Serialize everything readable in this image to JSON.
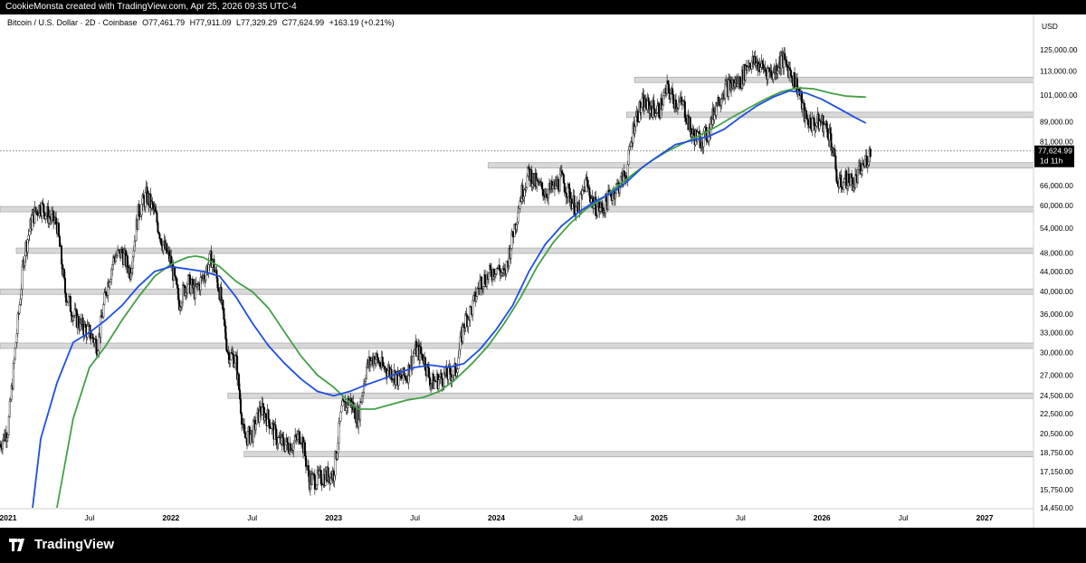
{
  "header": {
    "attribution": "CookieMonsta created with TradingView.com, Apr 25, 2026 09:35 UTC-4"
  },
  "footer": {
    "brand": "TradingView"
  },
  "chart_data": {
    "type": "candlestick",
    "symbol_line": "Bitcoin / U.S. Dollar · 2D · Coinbase",
    "ohlc": {
      "open_label": "O77,461.79",
      "high_label": "H77,911.09",
      "low_label": "L77,329.29",
      "close_label": "C77,624.99",
      "change_label": "+163.19 (+0.21%)"
    },
    "currency": "USD",
    "y_scale": "log",
    "ylim": [
      14450,
      131000
    ],
    "price_ticks": [
      "125,000.00",
      "113,000.00",
      "101,000.00",
      "89,000.00",
      "81,000.00",
      "66,000.00",
      "60,000.00",
      "54,000.00",
      "48,000.00",
      "44,000.00",
      "40,000.00",
      "36,000.00",
      "33,000.00",
      "30,000.00",
      "27,000.00",
      "24,500.00",
      "22,500.00",
      "20,500.00",
      "18,750.00",
      "17,150.00",
      "15,750.00",
      "14,450.00"
    ],
    "price_tick_values": [
      125000,
      113000,
      101000,
      89000,
      81000,
      66000,
      60000,
      54000,
      48000,
      44000,
      40000,
      36000,
      33000,
      30000,
      27000,
      24500,
      22500,
      20500,
      18750,
      17150,
      15750,
      14450
    ],
    "last_price": {
      "label": "77,624.99",
      "value": 77625,
      "countdown": "1d 11h"
    },
    "x_ticks": [
      {
        "label": "2021",
        "t": 2021.0,
        "bold": true
      },
      {
        "label": "Jul",
        "t": 2021.5,
        "bold": false
      },
      {
        "label": "2022",
        "t": 2022.0,
        "bold": true
      },
      {
        "label": "Jul",
        "t": 2022.5,
        "bold": false
      },
      {
        "label": "2023",
        "t": 2023.0,
        "bold": true
      },
      {
        "label": "Jul",
        "t": 2023.5,
        "bold": false
      },
      {
        "label": "2024",
        "t": 2024.0,
        "bold": true
      },
      {
        "label": "Jul",
        "t": 2024.5,
        "bold": false
      },
      {
        "label": "2025",
        "t": 2025.0,
        "bold": true
      },
      {
        "label": "Jul",
        "t": 2025.5,
        "bold": false
      },
      {
        "label": "2026",
        "t": 2026.0,
        "bold": true
      },
      {
        "label": "Jul",
        "t": 2026.5,
        "bold": false
      },
      {
        "label": "2027",
        "t": 2027.0,
        "bold": true
      }
    ],
    "xlim": [
      2020.95,
      2027.3
    ],
    "horizontal_levels": [
      {
        "price": 108500,
        "start": 2024.85
      },
      {
        "price": 92000,
        "start": 2024.8
      },
      {
        "price": 72500,
        "start": 2023.95
      },
      {
        "price": 59000,
        "start": 2020.95
      },
      {
        "price": 48500,
        "start": 2021.05
      },
      {
        "price": 40000,
        "start": 2020.95
      },
      {
        "price": 31000,
        "start": 2020.95
      },
      {
        "price": 24500,
        "start": 2022.35
      },
      {
        "price": 18600,
        "start": 2022.45
      }
    ],
    "price_path": [
      [
        2020.95,
        19500
      ],
      [
        2021.0,
        21000
      ],
      [
        2021.05,
        32000
      ],
      [
        2021.1,
        48000
      ],
      [
        2021.15,
        57000
      ],
      [
        2021.2,
        60000
      ],
      [
        2021.25,
        57000
      ],
      [
        2021.3,
        55000
      ],
      [
        2021.35,
        40000
      ],
      [
        2021.4,
        36000
      ],
      [
        2021.45,
        34000
      ],
      [
        2021.5,
        33000
      ],
      [
        2021.55,
        31000
      ],
      [
        2021.6,
        40000
      ],
      [
        2021.65,
        47000
      ],
      [
        2021.7,
        48000
      ],
      [
        2021.75,
        44000
      ],
      [
        2021.8,
        58000
      ],
      [
        2021.85,
        63000
      ],
      [
        2021.9,
        58000
      ],
      [
        2021.95,
        50000
      ],
      [
        2022.0,
        46000
      ],
      [
        2022.05,
        38000
      ],
      [
        2022.1,
        42000
      ],
      [
        2022.15,
        40000
      ],
      [
        2022.2,
        43000
      ],
      [
        2022.25,
        47000
      ],
      [
        2022.3,
        40000
      ],
      [
        2022.35,
        30000
      ],
      [
        2022.4,
        29000
      ],
      [
        2022.45,
        20000
      ],
      [
        2022.5,
        20500
      ],
      [
        2022.55,
        23000
      ],
      [
        2022.6,
        22000
      ],
      [
        2022.65,
        20000
      ],
      [
        2022.7,
        19500
      ],
      [
        2022.75,
        19500
      ],
      [
        2022.8,
        20500
      ],
      [
        2022.85,
        16500
      ],
      [
        2022.9,
        16500
      ],
      [
        2022.95,
        16800
      ],
      [
        2023.0,
        17000
      ],
      [
        2023.05,
        23000
      ],
      [
        2023.1,
        24000
      ],
      [
        2023.15,
        22000
      ],
      [
        2023.2,
        28000
      ],
      [
        2023.25,
        29500
      ],
      [
        2023.3,
        28000
      ],
      [
        2023.35,
        27500
      ],
      [
        2023.4,
        26500
      ],
      [
        2023.45,
        27000
      ],
      [
        2023.5,
        30500
      ],
      [
        2023.55,
        29500
      ],
      [
        2023.6,
        26000
      ],
      [
        2023.65,
        26500
      ],
      [
        2023.7,
        27000
      ],
      [
        2023.75,
        27500
      ],
      [
        2023.8,
        34500
      ],
      [
        2023.85,
        37000
      ],
      [
        2023.9,
        42000
      ],
      [
        2023.95,
        43000
      ],
      [
        2024.0,
        45000
      ],
      [
        2024.05,
        43000
      ],
      [
        2024.1,
        52000
      ],
      [
        2024.15,
        63000
      ],
      [
        2024.2,
        70000
      ],
      [
        2024.25,
        66000
      ],
      [
        2024.3,
        64000
      ],
      [
        2024.35,
        65000
      ],
      [
        2024.4,
        68000
      ],
      [
        2024.45,
        63000
      ],
      [
        2024.5,
        58000
      ],
      [
        2024.55,
        67000
      ],
      [
        2024.6,
        60000
      ],
      [
        2024.65,
        59000
      ],
      [
        2024.7,
        63000
      ],
      [
        2024.75,
        66000
      ],
      [
        2024.8,
        70000
      ],
      [
        2024.85,
        90000
      ],
      [
        2024.9,
        97000
      ],
      [
        2024.95,
        95000
      ],
      [
        2025.0,
        94000
      ],
      [
        2025.05,
        104000
      ],
      [
        2025.1,
        98000
      ],
      [
        2025.15,
        96000
      ],
      [
        2025.2,
        84000
      ],
      [
        2025.25,
        82000
      ],
      [
        2025.3,
        84000
      ],
      [
        2025.35,
        97000
      ],
      [
        2025.4,
        104000
      ],
      [
        2025.45,
        106000
      ],
      [
        2025.5,
        108000
      ],
      [
        2025.55,
        118000
      ],
      [
        2025.6,
        117000
      ],
      [
        2025.65,
        114000
      ],
      [
        2025.7,
        112000
      ],
      [
        2025.75,
        120000
      ],
      [
        2025.8,
        114000
      ],
      [
        2025.85,
        105000
      ],
      [
        2025.9,
        90000
      ],
      [
        2025.95,
        88000
      ],
      [
        2026.0,
        89000
      ],
      [
        2026.05,
        84000
      ],
      [
        2026.1,
        66000
      ],
      [
        2026.15,
        68000
      ],
      [
        2026.2,
        67000
      ],
      [
        2026.25,
        72000
      ],
      [
        2026.3,
        77500
      ]
    ],
    "ma_blue": [
      [
        2021.15,
        14450
      ],
      [
        2021.2,
        20000
      ],
      [
        2021.3,
        26000
      ],
      [
        2021.4,
        31500
      ],
      [
        2021.5,
        33000
      ],
      [
        2021.6,
        35000
      ],
      [
        2021.7,
        37500
      ],
      [
        2021.8,
        41000
      ],
      [
        2021.9,
        44000
      ],
      [
        2022.0,
        45000
      ],
      [
        2022.1,
        44500
      ],
      [
        2022.2,
        44000
      ],
      [
        2022.3,
        43000
      ],
      [
        2022.4,
        39000
      ],
      [
        2022.5,
        34500
      ],
      [
        2022.6,
        31000
      ],
      [
        2022.7,
        28500
      ],
      [
        2022.8,
        26500
      ],
      [
        2022.9,
        25000
      ],
      [
        2023.0,
        24500
      ],
      [
        2023.1,
        25000
      ],
      [
        2023.2,
        25800
      ],
      [
        2023.3,
        26500
      ],
      [
        2023.4,
        27300
      ],
      [
        2023.5,
        28000
      ],
      [
        2023.6,
        28300
      ],
      [
        2023.7,
        28000
      ],
      [
        2023.8,
        28500
      ],
      [
        2023.9,
        30500
      ],
      [
        2024.0,
        33500
      ],
      [
        2024.1,
        37500
      ],
      [
        2024.2,
        44000
      ],
      [
        2024.3,
        50000
      ],
      [
        2024.4,
        54500
      ],
      [
        2024.5,
        58000
      ],
      [
        2024.6,
        61000
      ],
      [
        2024.7,
        63500
      ],
      [
        2024.8,
        67000
      ],
      [
        2024.9,
        72000
      ],
      [
        2025.0,
        76000
      ],
      [
        2025.1,
        80000
      ],
      [
        2025.2,
        81500
      ],
      [
        2025.3,
        83000
      ],
      [
        2025.4,
        86000
      ],
      [
        2025.5,
        91000
      ],
      [
        2025.6,
        96000
      ],
      [
        2025.7,
        100000
      ],
      [
        2025.8,
        103000
      ],
      [
        2025.9,
        102000
      ],
      [
        2026.0,
        99000
      ],
      [
        2026.1,
        95000
      ],
      [
        2026.2,
        91000
      ],
      [
        2026.27,
        88500
      ]
    ],
    "ma_green": [
      [
        2021.3,
        14450
      ],
      [
        2021.4,
        22000
      ],
      [
        2021.5,
        28000
      ],
      [
        2021.6,
        31000
      ],
      [
        2021.7,
        35000
      ],
      [
        2021.8,
        39000
      ],
      [
        2021.9,
        43000
      ],
      [
        2022.0,
        45500
      ],
      [
        2022.1,
        47000
      ],
      [
        2022.15,
        47300
      ],
      [
        2022.2,
        47000
      ],
      [
        2022.3,
        45000
      ],
      [
        2022.4,
        42000
      ],
      [
        2022.5,
        40000
      ],
      [
        2022.6,
        37000
      ],
      [
        2022.7,
        33000
      ],
      [
        2022.8,
        29500
      ],
      [
        2022.9,
        27000
      ],
      [
        2023.0,
        25500
      ],
      [
        2023.1,
        23700
      ],
      [
        2023.15,
        23000
      ],
      [
        2023.25,
        23000
      ],
      [
        2023.35,
        23500
      ],
      [
        2023.45,
        24000
      ],
      [
        2023.55,
        24300
      ],
      [
        2023.65,
        25000
      ],
      [
        2023.75,
        26500
      ],
      [
        2023.85,
        28500
      ],
      [
        2023.95,
        31000
      ],
      [
        2024.05,
        34500
      ],
      [
        2024.15,
        39000
      ],
      [
        2024.25,
        45000
      ],
      [
        2024.35,
        50500
      ],
      [
        2024.45,
        55000
      ],
      [
        2024.55,
        59000
      ],
      [
        2024.65,
        62000
      ],
      [
        2024.75,
        66000
      ],
      [
        2024.85,
        70000
      ],
      [
        2024.95,
        74000
      ],
      [
        2025.05,
        77500
      ],
      [
        2025.15,
        80500
      ],
      [
        2025.25,
        83500
      ],
      [
        2025.35,
        87000
      ],
      [
        2025.45,
        91000
      ],
      [
        2025.55,
        95000
      ],
      [
        2025.65,
        99000
      ],
      [
        2025.75,
        102500
      ],
      [
        2025.85,
        104500
      ],
      [
        2025.95,
        104000
      ],
      [
        2026.05,
        102000
      ],
      [
        2026.15,
        100500
      ],
      [
        2026.27,
        100000
      ]
    ]
  }
}
